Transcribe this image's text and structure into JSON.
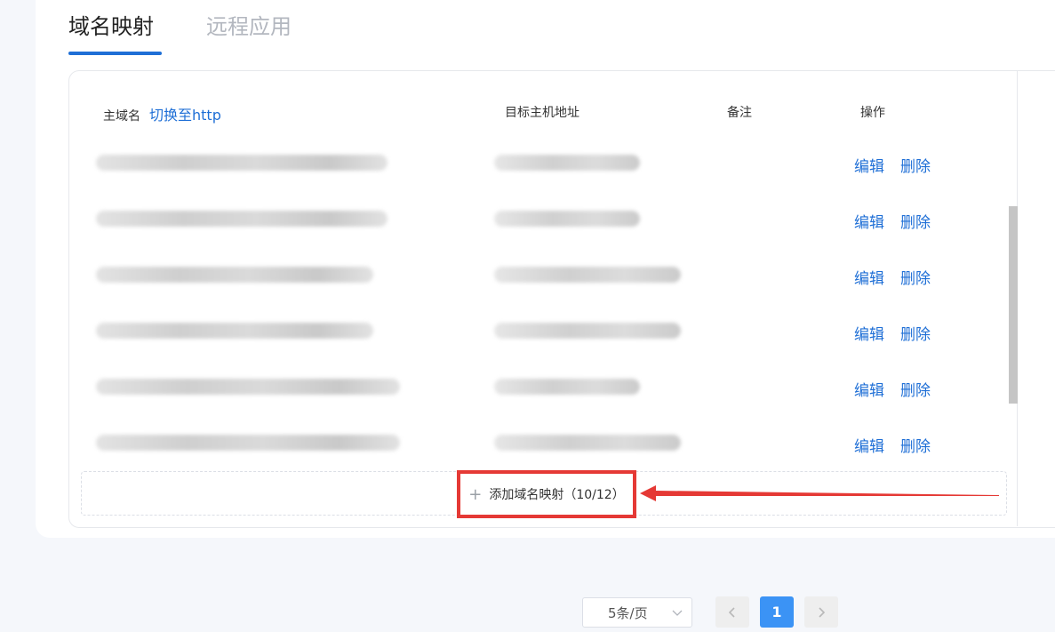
{
  "tabs": [
    {
      "label": "域名映射",
      "active": true
    },
    {
      "label": "远程应用",
      "active": false
    }
  ],
  "table": {
    "columns": {
      "main_domain": "主域名",
      "switch_link": "切换至http",
      "target_host": "目标主机地址",
      "remark": "备注",
      "actions": "操作"
    },
    "rows": [
      {
        "edit": "编辑",
        "delete": "删除"
      },
      {
        "edit": "编辑",
        "delete": "删除"
      },
      {
        "edit": "编辑",
        "delete": "删除"
      },
      {
        "edit": "编辑",
        "delete": "删除"
      },
      {
        "edit": "编辑",
        "delete": "删除"
      },
      {
        "edit": "编辑",
        "delete": "删除"
      }
    ]
  },
  "add_button": {
    "label": "添加域名映射（10/12）"
  },
  "pagination": {
    "page_size": "5条/页",
    "current_page": "1"
  },
  "colors": {
    "accent": "#1f6fd6",
    "highlight": "#e53935",
    "page_active": "#3b93f5"
  },
  "icons": [
    "plus-icon",
    "chevron-down-icon",
    "chevron-left-icon",
    "chevron-right-icon",
    "arrow-annotation-icon"
  ]
}
